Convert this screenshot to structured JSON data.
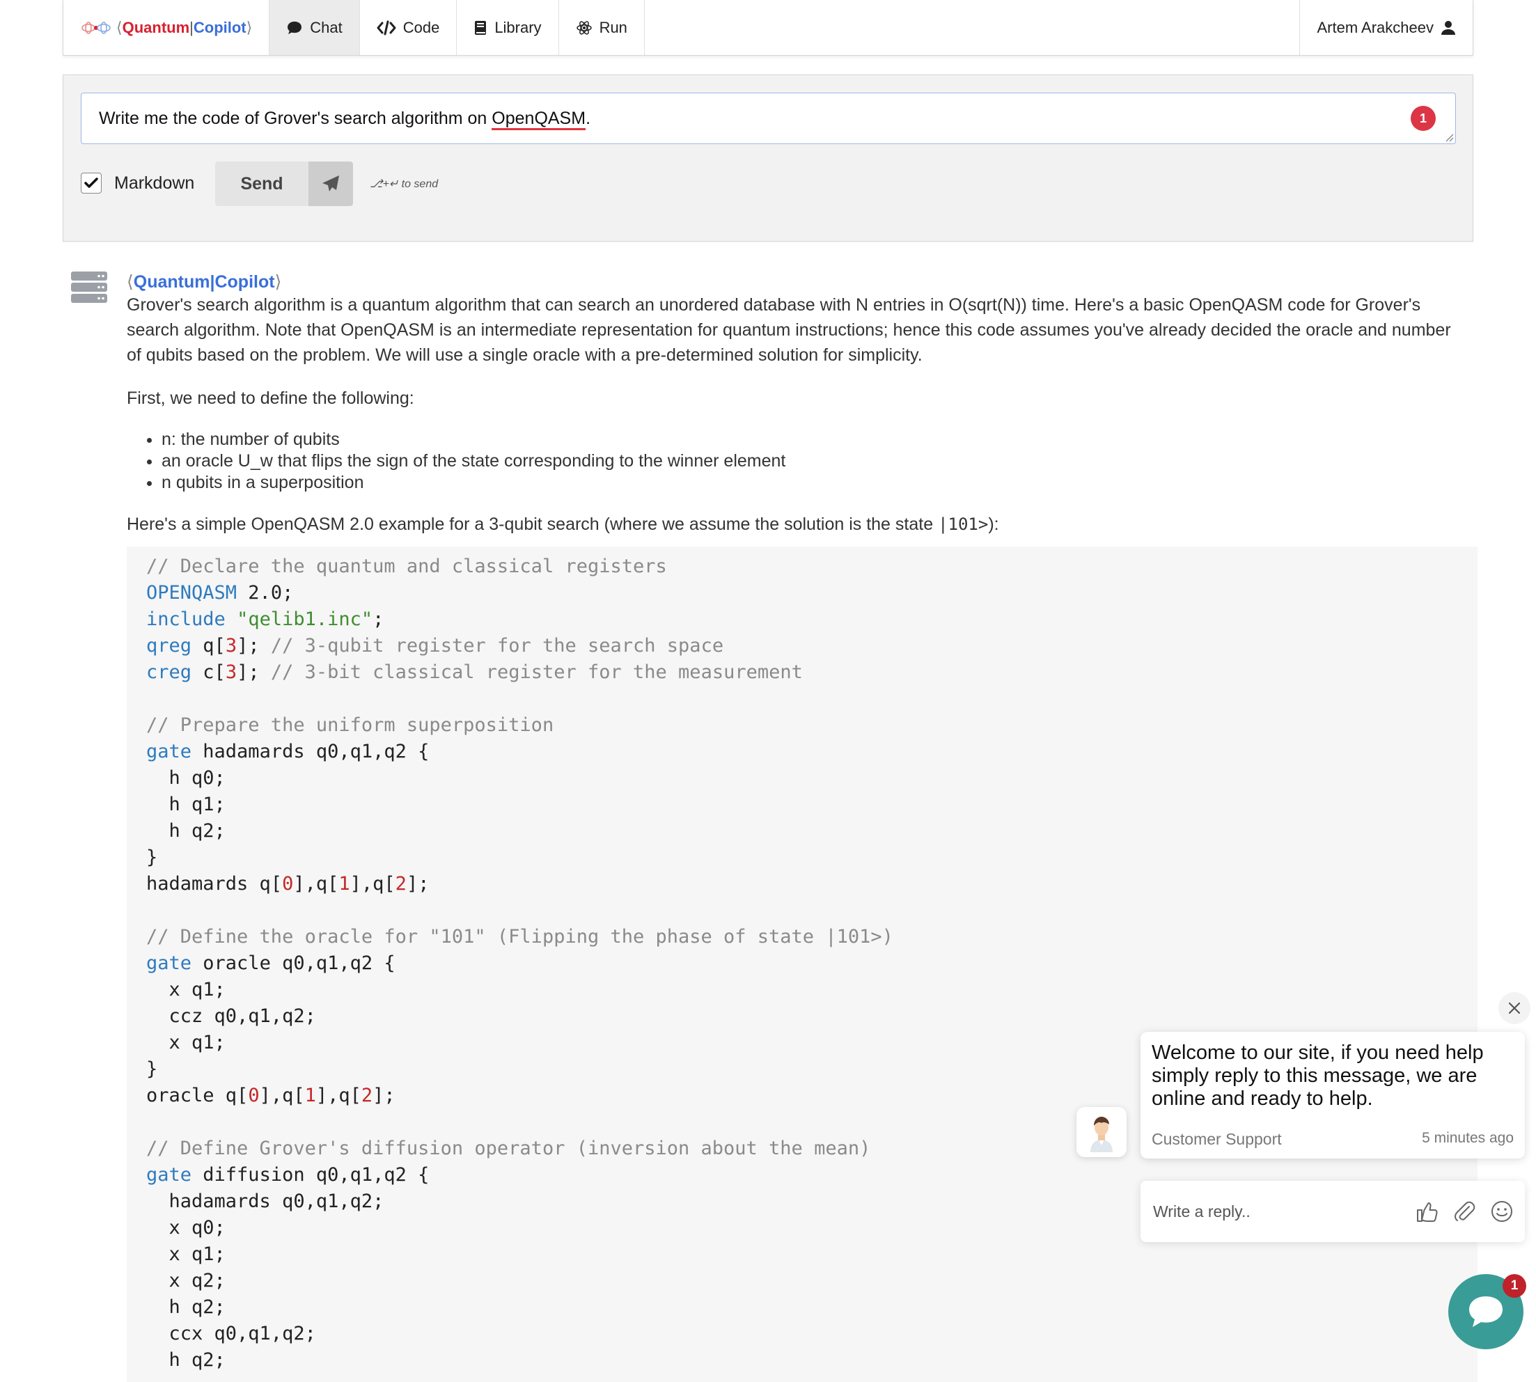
{
  "brand": {
    "quantum": "Quantum",
    "separator": "|",
    "copilot": "Copilot",
    "open": "⟨",
    "close": "⟩"
  },
  "nav": {
    "tabs": [
      {
        "label": "Chat",
        "icon": "speech-bubble-icon",
        "active": true
      },
      {
        "label": "Code",
        "icon": "code-icon"
      },
      {
        "label": "Library",
        "icon": "book-icon"
      },
      {
        "label": "Run",
        "icon": "atom-icon"
      }
    ],
    "user_name": "Artem Arakcheev"
  },
  "compose": {
    "prompt_before": "Write me the code of Grover's search algorithm on ",
    "prompt_spell": "OpenQASM",
    "prompt_after": ".",
    "badge_count": "1",
    "markdown_label": "Markdown",
    "markdown_checked": true,
    "send_label": "Send",
    "hint": "⎇+↵ to send"
  },
  "message": {
    "author_quantum": "Quantum",
    "author_copilot": "Copilot",
    "intro": "Grover's search algorithm is a quantum algorithm that can search an unordered database with N entries in O(sqrt(N)) time. Here's a basic OpenQASM code for Grover's search algorithm. Note that OpenQASM is an intermediate representation for quantum instructions; hence this code assumes you've already decided the oracle and number of qubits based on the problem. We will use a single oracle with a pre-determined solution for simplicity.",
    "first_need": "First, we need to define the following:",
    "bullets": [
      "n: the number of qubits",
      "an oracle U_w that flips the sign of the state corresponding to the winner element",
      "n qubits in a superposition"
    ],
    "example_before": "Here's a simple OpenQASM 2.0 example for a 3-qubit search (where we assume the solution is the state ",
    "example_state": "|101>",
    "example_after": "):"
  },
  "code": {
    "language": "OpenQASM",
    "lines": [
      "// Declare the quantum and classical registers",
      "OPENQASM 2.0;",
      "include \"qelib1.inc\";",
      "qreg q[3]; // 3-qubit register for the search space",
      "creg c[3]; // 3-bit classical register for the measurement",
      "",
      "// Prepare the uniform superposition",
      "gate hadamards q0,q1,q2 {",
      "  h q0;",
      "  h q1;",
      "  h q2;",
      "}",
      "hadamards q[0],q[1],q[2];",
      "",
      "// Define the oracle for \"101\" (Flipping the phase of state |101>)",
      "gate oracle q0,q1,q2 {",
      "  x q1;",
      "  ccz q0,q1,q2;",
      "  x q1;",
      "}",
      "oracle q[0],q[1],q[2];",
      "",
      "// Define Grover's diffusion operator (inversion about the mean)",
      "gate diffusion q0,q1,q2 {",
      "  hadamards q0,q1,q2;",
      "  x q0;",
      "  x q1;",
      "  x q2;",
      "  h q2;",
      "  ccx q0,q1,q2;",
      "  h q2;"
    ]
  },
  "chat_widget": {
    "welcome": "Welcome to our site, if you need help simply reply to this message, we are online and ready to help.",
    "sender": "Customer Support",
    "time": "5 minutes ago",
    "reply_placeholder": "Write a reply..",
    "launcher_badge": "1"
  },
  "colors": {
    "accent_red": "#d9202e",
    "accent_blue": "#3a6fd8",
    "launcher": "#3a9c97",
    "badge": "#dc3545"
  }
}
